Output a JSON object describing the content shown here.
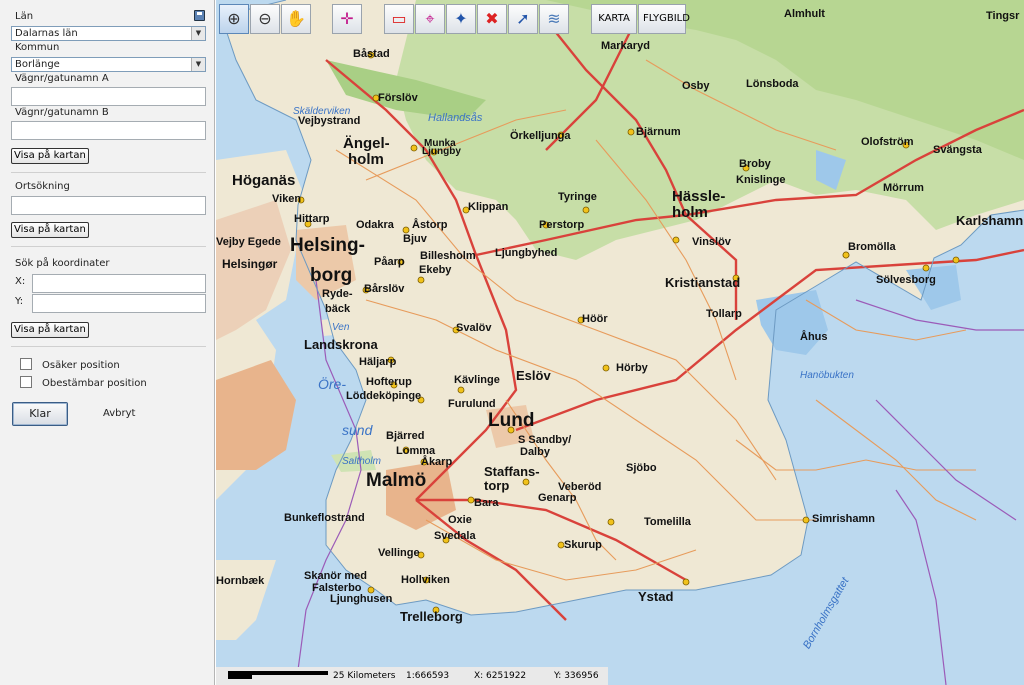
{
  "panel": {
    "lan_label": "Län",
    "lan_value": "Dalarnas län",
    "kommun_label": "Kommun",
    "kommun_value": "Borlänge",
    "vagA_label": "Vägnr/gatunamn A",
    "vagB_label": "Vägnr/gatunamn B",
    "show_button_1": "Visa på kartan",
    "ort_label": "Ortsökning",
    "show_button_2": "Visa på kartan",
    "coords_label": "Sök på koordinater",
    "x_label": "X:",
    "y_label": "Y:",
    "show_button_3": "Visa på kartan",
    "osaker_label": "Osäker position",
    "obestambar_label": "Obestämbar position",
    "klar_label": "Klar",
    "avbryt_label": "Avbryt"
  },
  "toolbar": {
    "karta_label": "KARTA",
    "flygbild_label": "FLYGBILD"
  },
  "status": {
    "scale_label": "25 Kilometers",
    "ratio": "1:666593",
    "x": "X:  6251922",
    "y": "Y:  336956"
  },
  "map": {
    "places": [
      "Almhult",
      "Tingsr",
      "Båstad",
      "Markaryd",
      "Osby",
      "Lönsboda",
      "Förslöv",
      "Vejbystrand",
      "Örkelljunga",
      "Bjärnum",
      "Ängel-",
      "holm",
      "Munka",
      "Ljungby",
      "Broby",
      "Knislinge",
      "Olofström",
      "Svängsta",
      "Höganäs",
      "Viken",
      "Hässle-",
      "holm",
      "Mörrum",
      "Karlshamn",
      "Hittarp",
      "Odakra",
      "Åstorp",
      "Klippan",
      "Tyringe",
      "Perstorp",
      "Vinslöv",
      "Bromölla",
      "Helsing-",
      "borg",
      "Bjuv",
      "Billesholm",
      "Ljungbyhed",
      "Kristianstad",
      "Sölvesborg",
      "Helsingør",
      "Påarp",
      "Ekeby",
      "Bårslöv",
      "Ryde-",
      "bäck",
      "Tollarp",
      "Åhus",
      "Höör",
      "Svalöv",
      "Landskrona",
      "Häljarp",
      "Hörby",
      "Eslöv",
      "Hofterup",
      "Löddeköpinge",
      "Kävlinge",
      "Furulund",
      "Lund",
      "S Sandby/",
      "Dalby",
      "Bjärred",
      "Lomma",
      "Åkarp",
      "Staffans-",
      "torp",
      "Sjöbo",
      "Malmö",
      "Veberöd",
      "Genarp",
      "Bara",
      "Bunkeflostrand",
      "Oxie",
      "Tomelilla",
      "Simrishamn",
      "Svedala",
      "Skurup",
      "Vellinge",
      "Hollviken",
      "Skanör med",
      "Falsterbo",
      "Ljunghusen",
      "Ystad",
      "Trelleborg",
      "Hornbæk",
      "Vejby Egede"
    ],
    "water": [
      "Skälderviken",
      "Hallandsås",
      "Hanöbukten",
      "Öre-",
      "sund",
      "Saltholm",
      "Bornholmsgattet",
      "Ven"
    ]
  }
}
